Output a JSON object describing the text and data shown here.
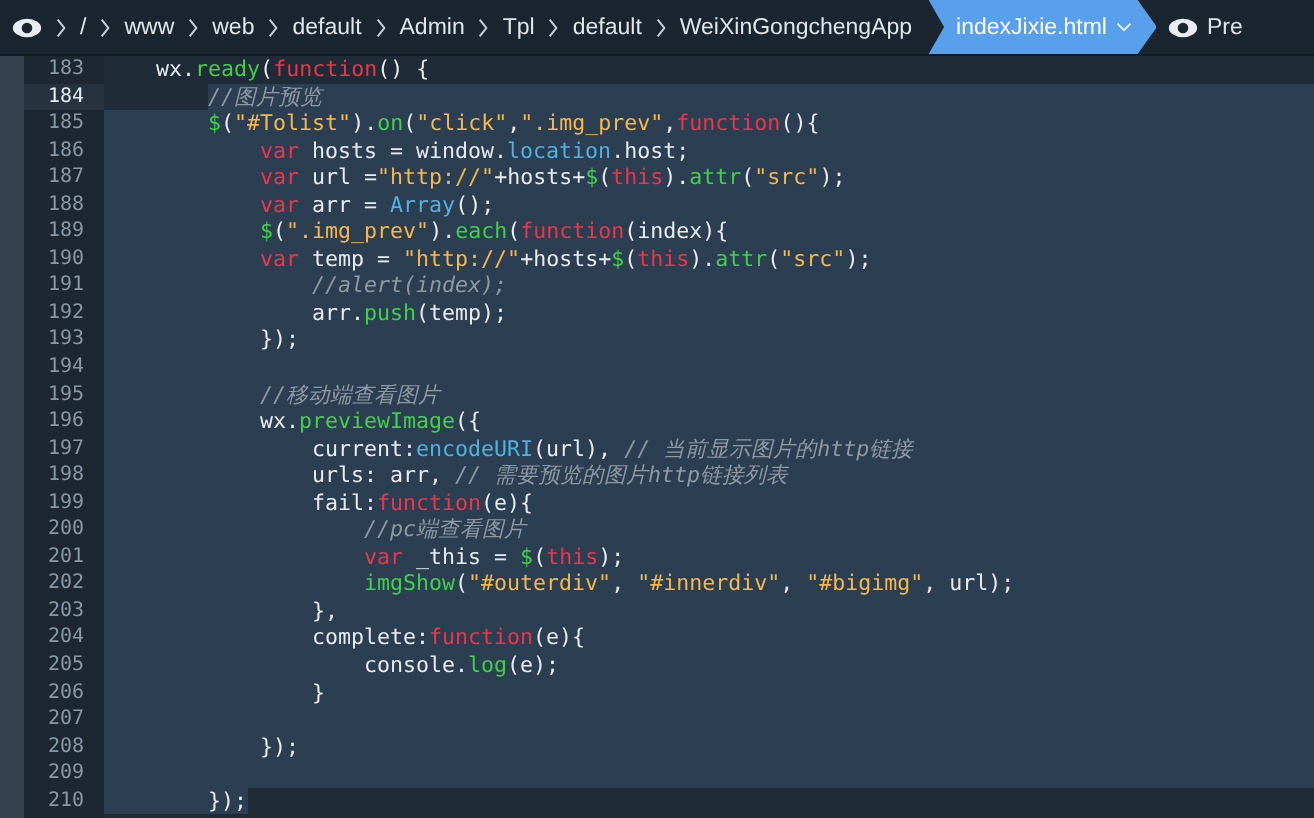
{
  "breadcrumbs": [
    "/",
    "www",
    "web",
    "default",
    "Admin",
    "Tpl",
    "default",
    "WeiXinGongchengApp"
  ],
  "active_tab": {
    "label": "indexJixie.html",
    "selected": true
  },
  "preview_label": "Pre",
  "lines": [
    {
      "number": "183",
      "selected": false,
      "tokens": [
        {
          "text": "    wx.",
          "kind": "plain"
        },
        {
          "text": "ready",
          "kind": "func"
        },
        {
          "text": "(",
          "kind": "plain"
        },
        {
          "text": "function",
          "kind": "keyword"
        },
        {
          "text": "() {",
          "kind": "plain"
        }
      ]
    },
    {
      "number": "184",
      "selected": true,
      "tokens": [
        {
          "text": "        //图片预览",
          "kind": "comment"
        }
      ]
    },
    {
      "number": "185",
      "selected": true,
      "tokens": [
        {
          "text": "        $",
          "kind": "func"
        },
        {
          "text": "(",
          "kind": "plain"
        },
        {
          "text": "\"#Tolist\"",
          "kind": "string"
        },
        {
          "text": ").",
          "kind": "plain"
        },
        {
          "text": "on",
          "kind": "func"
        },
        {
          "text": "(",
          "kind": "plain"
        },
        {
          "text": "\"click\"",
          "kind": "string"
        },
        {
          "text": ",",
          "kind": "plain"
        },
        {
          "text": "\".img_prev\"",
          "kind": "string"
        },
        {
          "text": ",",
          "kind": "plain"
        },
        {
          "text": "function",
          "kind": "keyword"
        },
        {
          "text": "(){",
          "kind": "plain"
        }
      ]
    },
    {
      "number": "186",
      "selected": true,
      "tokens": [
        {
          "text": "            var",
          "kind": "keyword"
        },
        {
          "text": " hosts = window.",
          "kind": "plain"
        },
        {
          "text": "location",
          "kind": "builtin"
        },
        {
          "text": ".host;",
          "kind": "plain"
        }
      ]
    },
    {
      "number": "187",
      "selected": true,
      "tokens": [
        {
          "text": "            var",
          "kind": "keyword"
        },
        {
          "text": " url =",
          "kind": "plain"
        },
        {
          "text": "\"http://\"",
          "kind": "string"
        },
        {
          "text": "+hosts+",
          "kind": "plain"
        },
        {
          "text": "$",
          "kind": "func"
        },
        {
          "text": "(",
          "kind": "plain"
        },
        {
          "text": "this",
          "kind": "keyword"
        },
        {
          "text": ").",
          "kind": "plain"
        },
        {
          "text": "attr",
          "kind": "func"
        },
        {
          "text": "(",
          "kind": "plain"
        },
        {
          "text": "\"src\"",
          "kind": "string"
        },
        {
          "text": ");",
          "kind": "plain"
        }
      ]
    },
    {
      "number": "188",
      "selected": true,
      "tokens": [
        {
          "text": "            var",
          "kind": "keyword"
        },
        {
          "text": " arr = ",
          "kind": "plain"
        },
        {
          "text": "Array",
          "kind": "builtin"
        },
        {
          "text": "();",
          "kind": "plain"
        }
      ]
    },
    {
      "number": "189",
      "selected": true,
      "tokens": [
        {
          "text": "            $",
          "kind": "func"
        },
        {
          "text": "(",
          "kind": "plain"
        },
        {
          "text": "\".img_prev\"",
          "kind": "string"
        },
        {
          "text": ").",
          "kind": "plain"
        },
        {
          "text": "each",
          "kind": "func"
        },
        {
          "text": "(",
          "kind": "plain"
        },
        {
          "text": "function",
          "kind": "keyword"
        },
        {
          "text": "(index){",
          "kind": "plain"
        }
      ]
    },
    {
      "number": "190",
      "selected": true,
      "tokens": [
        {
          "text": "            var",
          "kind": "keyword"
        },
        {
          "text": " temp = ",
          "kind": "plain"
        },
        {
          "text": "\"http://\"",
          "kind": "string"
        },
        {
          "text": "+hosts+",
          "kind": "plain"
        },
        {
          "text": "$",
          "kind": "func"
        },
        {
          "text": "(",
          "kind": "plain"
        },
        {
          "text": "this",
          "kind": "keyword"
        },
        {
          "text": ").",
          "kind": "plain"
        },
        {
          "text": "attr",
          "kind": "func"
        },
        {
          "text": "(",
          "kind": "plain"
        },
        {
          "text": "\"src\"",
          "kind": "string"
        },
        {
          "text": ");",
          "kind": "plain"
        }
      ]
    },
    {
      "number": "191",
      "selected": true,
      "tokens": [
        {
          "text": "                //alert(index);",
          "kind": "comment"
        }
      ]
    },
    {
      "number": "192",
      "selected": true,
      "tokens": [
        {
          "text": "                arr.",
          "kind": "plain"
        },
        {
          "text": "push",
          "kind": "func"
        },
        {
          "text": "(temp);",
          "kind": "plain"
        }
      ]
    },
    {
      "number": "193",
      "selected": true,
      "tokens": [
        {
          "text": "            });",
          "kind": "plain"
        }
      ]
    },
    {
      "number": "194",
      "selected": true
    },
    {
      "number": "195",
      "selected": true,
      "tokens": [
        {
          "text": "            //移动端查看图片",
          "kind": "comment"
        }
      ]
    },
    {
      "number": "196",
      "selected": true,
      "tokens": [
        {
          "text": "            wx.",
          "kind": "plain"
        },
        {
          "text": "previewImage",
          "kind": "func"
        },
        {
          "text": "({",
          "kind": "plain"
        }
      ]
    },
    {
      "number": "197",
      "selected": true,
      "tokens": [
        {
          "text": "                current:",
          "kind": "plain"
        },
        {
          "text": "encodeURI",
          "kind": "builtin"
        },
        {
          "text": "(url), ",
          "kind": "plain"
        },
        {
          "text": "// 当前显示图片的http链接",
          "kind": "comment"
        }
      ]
    },
    {
      "number": "198",
      "selected": true,
      "tokens": [
        {
          "text": "                urls: arr, ",
          "kind": "plain"
        },
        {
          "text": "// 需要预览的图片http链接列表",
          "kind": "comment"
        }
      ]
    },
    {
      "number": "199",
      "selected": true,
      "tokens": [
        {
          "text": "                fail:",
          "kind": "plain"
        },
        {
          "text": "function",
          "kind": "keyword"
        },
        {
          "text": "(e){",
          "kind": "plain"
        }
      ]
    },
    {
      "number": "200",
      "selected": true,
      "tokens": [
        {
          "text": "                    //pc端查看图片",
          "kind": "comment"
        }
      ]
    },
    {
      "number": "201",
      "selected": true,
      "tokens": [
        {
          "text": "                    var",
          "kind": "keyword"
        },
        {
          "text": " _this = ",
          "kind": "plain"
        },
        {
          "text": "$",
          "kind": "func"
        },
        {
          "text": "(",
          "kind": "plain"
        },
        {
          "text": "this",
          "kind": "keyword"
        },
        {
          "text": ");",
          "kind": "plain"
        }
      ]
    },
    {
      "number": "202",
      "selected": true,
      "tokens": [
        {
          "text": "                    imgShow",
          "kind": "func"
        },
        {
          "text": "(",
          "kind": "plain"
        },
        {
          "text": "\"#outerdiv\"",
          "kind": "string"
        },
        {
          "text": ", ",
          "kind": "plain"
        },
        {
          "text": "\"#innerdiv\"",
          "kind": "string"
        },
        {
          "text": ", ",
          "kind": "plain"
        },
        {
          "text": "\"#bigimg\"",
          "kind": "string"
        },
        {
          "text": ", url);",
          "kind": "plain"
        }
      ]
    },
    {
      "number": "203",
      "selected": true,
      "tokens": [
        {
          "text": "                },",
          "kind": "plain"
        }
      ]
    },
    {
      "number": "204",
      "selected": true,
      "tokens": [
        {
          "text": "                complete:",
          "kind": "plain"
        },
        {
          "text": "function",
          "kind": "keyword"
        },
        {
          "text": "(e){",
          "kind": "plain"
        }
      ]
    },
    {
      "number": "205",
      "selected": true,
      "tokens": [
        {
          "text": "                    console.",
          "kind": "plain"
        },
        {
          "text": "log",
          "kind": "func"
        },
        {
          "text": "(e);",
          "kind": "plain"
        }
      ]
    },
    {
      "number": "206",
      "selected": true,
      "tokens": [
        {
          "text": "                }",
          "kind": "plain"
        }
      ]
    },
    {
      "number": "207",
      "selected": true
    },
    {
      "number": "208",
      "selected": true,
      "tokens": [
        {
          "text": "            });",
          "kind": "plain"
        }
      ]
    },
    {
      "number": "209",
      "selected": true
    },
    {
      "number": "210",
      "selected": true,
      "tokens": [
        {
          "text": "        });",
          "kind": "plain"
        }
      ]
    }
  ]
}
